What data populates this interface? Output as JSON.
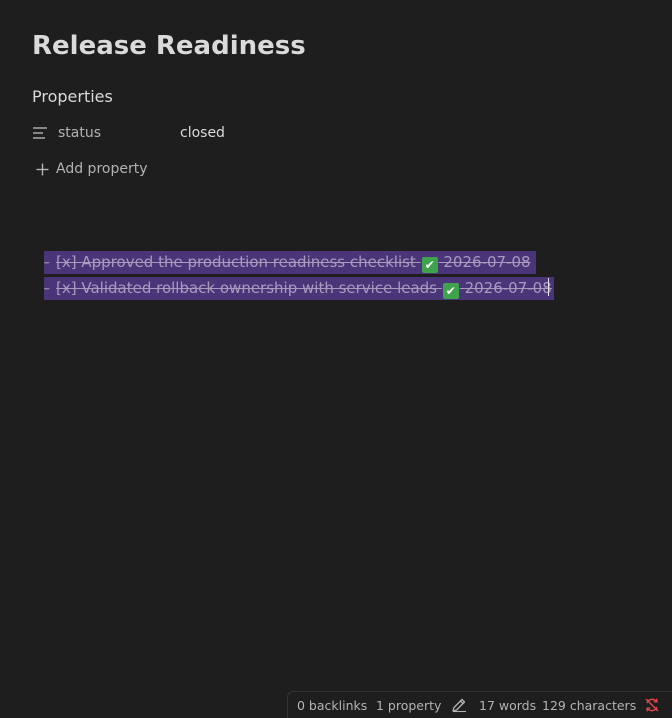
{
  "note": {
    "title": "Release Readiness"
  },
  "properties": {
    "heading": "Properties",
    "items": [
      {
        "key": "status",
        "value": "closed",
        "icon": "text-lines-icon"
      }
    ],
    "add_label": "Add property"
  },
  "tasks": [
    {
      "marker": "[x]",
      "text": "Approved the production readiness checklist",
      "done_icon": "✅",
      "date": "2026-07-08"
    },
    {
      "marker": "[x]",
      "text": "Validated rollback ownership with service leads",
      "done_icon": "✅",
      "date": "2026-07-08"
    }
  ],
  "status_bar": {
    "backlinks": "0 backlinks",
    "properties": "1 property",
    "words": "17 words",
    "characters": "129 characters",
    "edit_icon": "pencil-icon",
    "sync_icon": "sync-off-icon"
  },
  "colors": {
    "background": "#1e1e1e",
    "selection": "#4a3578",
    "sync_error": "#e5484d"
  }
}
